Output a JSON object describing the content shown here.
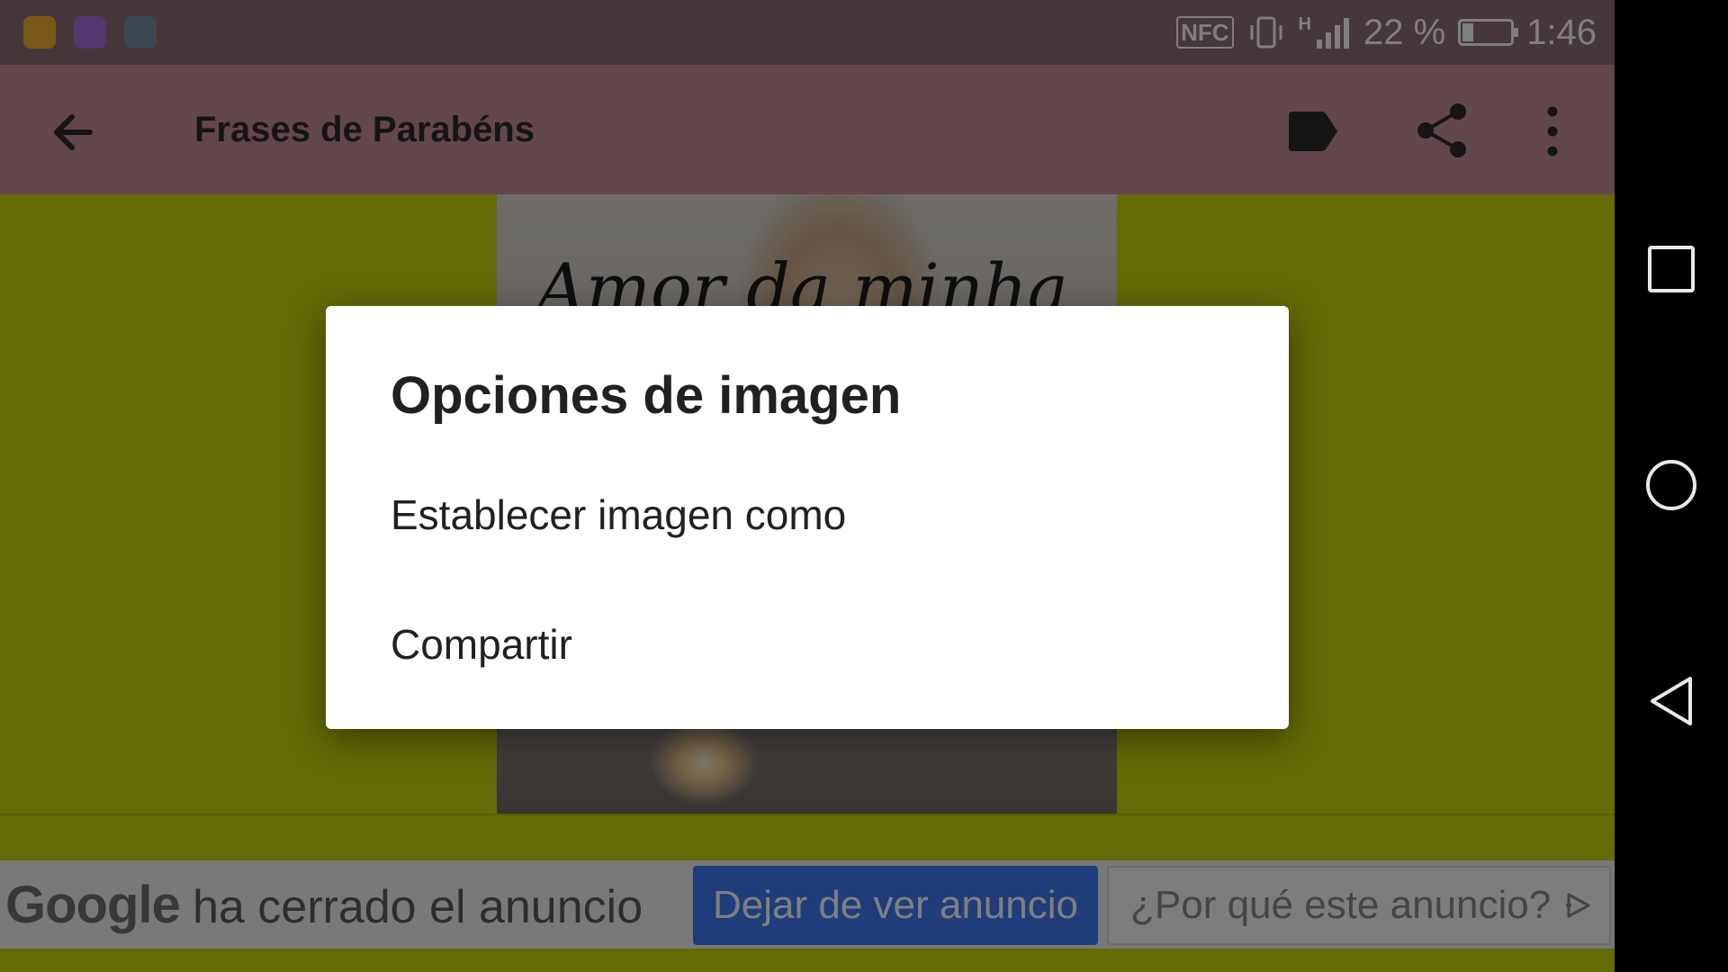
{
  "status_bar": {
    "nfc": "NFC",
    "network_type": "H",
    "battery_percent": "22 %",
    "battery_level": 0.22,
    "time": "1:46",
    "notification_icons": [
      "orange-app-icon",
      "purple-gallery-icon",
      "chart-icon"
    ]
  },
  "app_bar": {
    "title": "Frases de Parabéns",
    "icons": [
      "back-arrow-icon",
      "label-icon",
      "share-icon",
      "more-vert-icon"
    ]
  },
  "image": {
    "overlay_text": "Amor da minha"
  },
  "dialog": {
    "title": "Opciones de imagen",
    "items": [
      "Establecer imagen como",
      "Compartir"
    ]
  },
  "ad_bar": {
    "brand": "Google",
    "closed_text": "ha cerrado el anuncio",
    "stop_button": "Dejar de ver anuncio",
    "why_button": "¿Por qué este anuncio?"
  },
  "nav_bar": {
    "icons": [
      "recents-square-icon",
      "home-circle-icon",
      "back-triangle-icon"
    ]
  },
  "colors": {
    "status_bar": "#8d6f75",
    "app_bar": "#c98c9b",
    "content_background": "#c8d40c",
    "ad_button": "#3e7bf7",
    "dialog": "#ffffff"
  }
}
